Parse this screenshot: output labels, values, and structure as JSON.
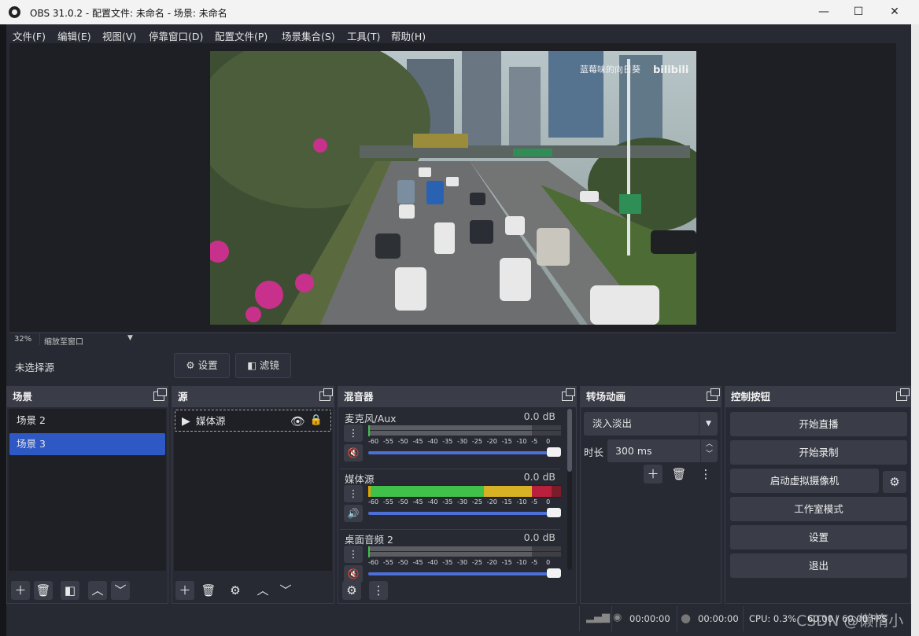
{
  "window": {
    "title": "OBS 31.0.2 - 配置文件: 未命名 - 场景: 未命名",
    "minimize": "—",
    "maximize": "☐",
    "close": "✕"
  },
  "menu": [
    "文件(F)",
    "编辑(E)",
    "视图(V)",
    "停靠窗口(D)",
    "配置文件(P)",
    "场景集合(S)",
    "工具(T)",
    "帮助(H)"
  ],
  "preview": {
    "watermark": "蓝莓味的向日葵",
    "logo": "bilibili",
    "zoom_percent": "32%",
    "zoom_mode": "缩放至窗口"
  },
  "source_toolbar": {
    "no_source": "未选择源",
    "properties": "设置",
    "filters": "滤镜"
  },
  "scenes": {
    "title": "场景",
    "items": [
      "场景 2",
      "场景 3"
    ],
    "selected": "场景 3",
    "buttons": [
      "add",
      "remove",
      "filters",
      "up",
      "down"
    ]
  },
  "sources": {
    "title": "源",
    "items": [
      {
        "name": "媒体源",
        "visible": true,
        "locked": true
      }
    ]
  },
  "mixer": {
    "title": "混音器",
    "scale": [
      "-60",
      "-55",
      "-50",
      "-45",
      "-40",
      "-35",
      "-30",
      "-25",
      "-20",
      "-15",
      "-10",
      "-5",
      "0"
    ],
    "channels": [
      {
        "name": "麦克风/Aux",
        "db": "0.0 dB",
        "muted": true,
        "level": 0,
        "volume": 1
      },
      {
        "name": "媒体源",
        "db": "0.0 dB",
        "muted": false,
        "level": 0.95,
        "volume": 1
      },
      {
        "name": "桌面音频 2",
        "db": "0.0 dB",
        "muted": true,
        "level": 0,
        "volume": 1
      }
    ]
  },
  "transitions": {
    "title": "转场动画",
    "selected": "淡入淡出",
    "duration_label": "时长",
    "duration_value": "300 ms"
  },
  "controls": {
    "title": "控制按钮",
    "start_stream": "开始直播",
    "start_record": "开始录制",
    "virtual_cam": "启动虚拟摄像机",
    "studio_mode": "工作室模式",
    "settings": "设置",
    "exit": "退出"
  },
  "status": {
    "stream_time": "00:00:00",
    "record_time": "00:00:00",
    "cpu": "CPU: 0.3%",
    "fps": "60.00 / 60.00 FPS"
  },
  "overlay_text": "CSDN @懒惰小"
}
